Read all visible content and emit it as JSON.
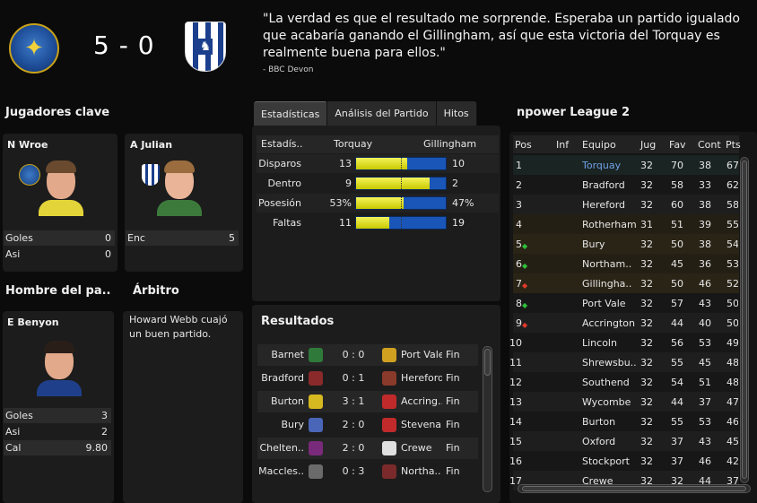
{
  "header": {
    "score": "5 - 0",
    "quote": "\"La verdad es que el resultado me sorprende. Esperaba un partido igualado que acabaría ganando el Gillingham, así que esta victoria del Torquay es realmente buena para ellos.\"",
    "quote_source": "- BBC Devon",
    "home_crest_icon": "torquay-crest-icon",
    "away_crest_icon": "gillingham-crest-icon"
  },
  "key_players": {
    "title": "Jugadores clave",
    "home": {
      "name": "N Wroe",
      "stat_label": "Goles",
      "stat_value": "0",
      "stat2_label": "Asi",
      "stat2_value": "0"
    },
    "away": {
      "name": "A Julian",
      "stat_label": "Enc",
      "stat_value": "5"
    }
  },
  "man_of_match": {
    "title": "Hombre del pa..",
    "name": "E Benyon",
    "stats": [
      {
        "label": "Goles",
        "value": "3"
      },
      {
        "label": "Asi",
        "value": "2"
      },
      {
        "label": "Cal",
        "value": "9.80"
      }
    ]
  },
  "referee": {
    "title": "Árbitro",
    "text": "Howard Webb cuajó un buen partido."
  },
  "stats_tabs": [
    "Estadísticas",
    "Análisis del Partido",
    "Hitos"
  ],
  "stats_table": {
    "head": [
      "Estadís..",
      "Torquay",
      "Gillingham"
    ],
    "rows": [
      {
        "label": "Disparos",
        "home": "13",
        "away": "10",
        "home_share": 0.565
      },
      {
        "label": "Dentro",
        "home": "9",
        "away": "2",
        "home_share": 0.818
      },
      {
        "label": "Posesión",
        "home": "53%",
        "away": "47%",
        "home_share": 0.53
      },
      {
        "label": "Faltas",
        "home": "11",
        "away": "19",
        "home_share": 0.367
      }
    ]
  },
  "results": {
    "title": "Resultados",
    "rows": [
      {
        "home": "Barnet",
        "score": "0 : 0",
        "away": "Port Vale",
        "status": "Fin"
      },
      {
        "home": "Bradford",
        "score": "0 : 1",
        "away": "Hereford",
        "status": "Fin"
      },
      {
        "home": "Burton",
        "score": "3 : 1",
        "away": "Accring..",
        "status": "Fin"
      },
      {
        "home": "Bury",
        "score": "2 : 0",
        "away": "Stevena..",
        "status": "Fin"
      },
      {
        "home": "Chelten..",
        "score": "2 : 0",
        "away": "Crewe",
        "status": "Fin"
      },
      {
        "home": "Maccles..",
        "score": "0 : 3",
        "away": "Northa..",
        "status": "Fin"
      }
    ]
  },
  "league": {
    "title": "npower League 2",
    "columns": [
      "Pos",
      "Inf",
      "Equipo",
      "Jug",
      "Fav",
      "Cont",
      "Pts"
    ],
    "rows": [
      {
        "pos": "1",
        "trend": "",
        "team": "Torquay",
        "jug": "32",
        "fav": "70",
        "cont": "38",
        "pts": "67",
        "highlight": true
      },
      {
        "pos": "2",
        "trend": "",
        "team": "Bradford",
        "jug": "32",
        "fav": "58",
        "cont": "33",
        "pts": "62"
      },
      {
        "pos": "3",
        "trend": "",
        "team": "Hereford",
        "jug": "32",
        "fav": "60",
        "cont": "38",
        "pts": "58"
      },
      {
        "pos": "4",
        "trend": "",
        "team": "Rotherham",
        "jug": "31",
        "fav": "51",
        "cont": "39",
        "pts": "55"
      },
      {
        "pos": "5",
        "trend": "up",
        "team": "Bury",
        "jug": "32",
        "fav": "50",
        "cont": "38",
        "pts": "54"
      },
      {
        "pos": "6",
        "trend": "up",
        "team": "Northam..",
        "jug": "32",
        "fav": "45",
        "cont": "36",
        "pts": "53"
      },
      {
        "pos": "7",
        "trend": "down",
        "team": "Gillingha..",
        "jug": "32",
        "fav": "50",
        "cont": "46",
        "pts": "52"
      },
      {
        "pos": "8",
        "trend": "up",
        "team": "Port Vale",
        "jug": "32",
        "fav": "57",
        "cont": "43",
        "pts": "50"
      },
      {
        "pos": "9",
        "trend": "down",
        "team": "Accrington",
        "jug": "32",
        "fav": "44",
        "cont": "40",
        "pts": "50"
      },
      {
        "pos": "10",
        "trend": "",
        "team": "Lincoln",
        "jug": "32",
        "fav": "56",
        "cont": "53",
        "pts": "49"
      },
      {
        "pos": "11",
        "trend": "",
        "team": "Shrewsbu..",
        "jug": "32",
        "fav": "55",
        "cont": "45",
        "pts": "48"
      },
      {
        "pos": "12",
        "trend": "",
        "team": "Southend",
        "jug": "32",
        "fav": "54",
        "cont": "51",
        "pts": "48"
      },
      {
        "pos": "13",
        "trend": "",
        "team": "Wycombe",
        "jug": "32",
        "fav": "44",
        "cont": "37",
        "pts": "47"
      },
      {
        "pos": "14",
        "trend": "",
        "team": "Burton",
        "jug": "32",
        "fav": "55",
        "cont": "53",
        "pts": "46"
      },
      {
        "pos": "15",
        "trend": "",
        "team": "Oxford",
        "jug": "32",
        "fav": "37",
        "cont": "43",
        "pts": "45"
      },
      {
        "pos": "16",
        "trend": "",
        "team": "Stockport",
        "jug": "32",
        "fav": "37",
        "cont": "46",
        "pts": "42"
      },
      {
        "pos": "17",
        "trend": "",
        "team": "Crewe",
        "jug": "32",
        "fav": "32",
        "cont": "44",
        "pts": "37"
      }
    ]
  },
  "colors": {
    "home_bar": "#e0e020",
    "away_bar": "#1a56b8",
    "highlight_team": "#6fa0e8",
    "trend_up": "#2fbf3a",
    "trend_down": "#e23a2a"
  }
}
